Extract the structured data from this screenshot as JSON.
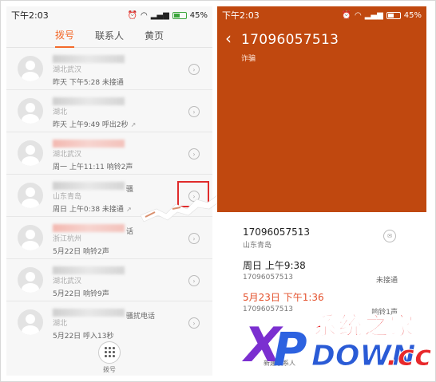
{
  "left": {
    "status": {
      "time": "下午2:03",
      "battery": "45%"
    },
    "tabs": [
      "拨号",
      "联系人",
      "黄页"
    ],
    "calls": [
      {
        "location": "湖北武汉",
        "meta": "昨天 下午5:28 未接通",
        "arrow": "",
        "note": "",
        "redacted_red": false
      },
      {
        "location": "湖北",
        "meta": "昨天 上午9:49 呼出2秒",
        "arrow": "↗",
        "note": "",
        "redacted_red": false
      },
      {
        "location": "湖北武汉",
        "meta": "周一 上午11:11 响铃2声",
        "arrow": "",
        "note": "",
        "redacted_red": true
      },
      {
        "location": "山东青岛",
        "meta": "周日 上午0:38 未接通",
        "arrow": "↗",
        "note": "骚",
        "redacted_red": false,
        "highlighted": true
      },
      {
        "location": "浙江杭州",
        "meta": "5月22日 响铃2声",
        "arrow": "",
        "note": "话",
        "redacted_red": true
      },
      {
        "location": "湖北武汉",
        "meta": "5月22日 响铃9声",
        "arrow": "",
        "note": "",
        "redacted_red": false
      },
      {
        "location": "湖北",
        "meta": "5月22日 呼入13秒",
        "arrow": "",
        "note": "骚扰电话",
        "redacted_red": false
      }
    ],
    "dialpad_label": "拨号"
  },
  "right": {
    "status": {
      "time": "下午2:03",
      "battery": "45%"
    },
    "number": "17096057513",
    "tag": "诈骗",
    "details": [
      {
        "title": "17096057513",
        "sub": "山东青岛",
        "status": "",
        "red": false
      },
      {
        "title": "周日 上午9:38",
        "sub": "17096057513",
        "status": "未接通",
        "red": false
      },
      {
        "title": "5月23日 下午1:36",
        "sub": "17096057513",
        "status": "响铃1声",
        "red": true
      }
    ],
    "new_contact": "新建联系人"
  },
  "watermark": {
    "x": "X",
    "p": "P",
    "cn": "系统之家",
    "down": "DOWN",
    "cc": ".cc"
  },
  "colors": {
    "accent": "#f36a2b",
    "header": "#c0480f",
    "highlight": "#e02b2b"
  }
}
